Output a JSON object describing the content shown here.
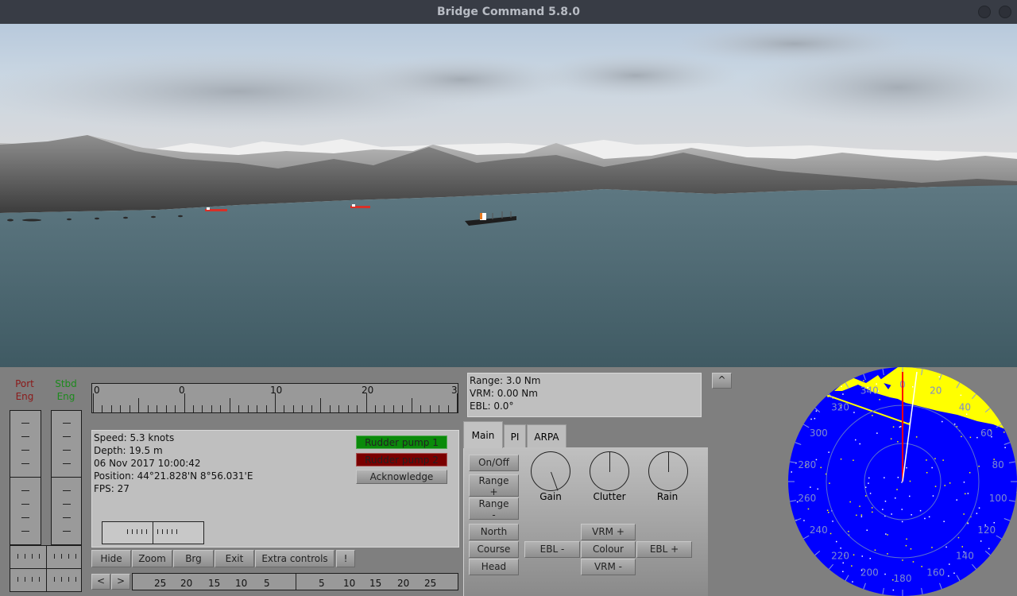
{
  "window": {
    "title": "Bridge Command 5.8.0",
    "controls": [
      "minimize-button",
      "close-button"
    ]
  },
  "viewport": {
    "scene": "3D bridge view: overcast sky, grey mountain range along coastline, calm teal sea",
    "vessels": [
      {
        "name": "red-vessel-1",
        "color": "#d83028"
      },
      {
        "name": "red-vessel-2",
        "color": "#d83028"
      },
      {
        "name": "cargo-ship",
        "color": "#1e1e1e"
      }
    ]
  },
  "engines": {
    "port_label": "Port\nEng",
    "stbd_label": "Stbd\nEng",
    "port_color": "#8b1a1a",
    "stbd_color": "#1d8a1d"
  },
  "heading_scale": {
    "labels": [
      "0",
      "0",
      "10",
      "20",
      "3"
    ]
  },
  "info": {
    "speed": "Speed: 5.3 knots",
    "depth": "Depth: 19.5 m",
    "datetime": "06 Nov 2017 10:00:42",
    "position": "Position: 44°21.828'N 8°56.031'E",
    "fps": "FPS: 27"
  },
  "alarms": {
    "rudder_pump_1": {
      "label": "Rudder pump 1",
      "color": "#0a8a0a"
    },
    "rudder_pump_2": {
      "label": "Rudder pump 2",
      "color": "#7a0000"
    },
    "acknowledge": "Acknowledge"
  },
  "toolbar": {
    "hide": "Hide",
    "zoom": "Zoom",
    "brg": "Brg",
    "exit": "Exit",
    "extra_controls": "Extra controls",
    "alert": "!"
  },
  "rudder_scale": {
    "prev": "<",
    "next": ">",
    "port_labels": [
      "25",
      "20",
      "15",
      "10",
      "5"
    ],
    "stbd_labels": [
      "5",
      "10",
      "15",
      "20",
      "25"
    ]
  },
  "radar_info": {
    "range": "Range: 3.0 Nm",
    "vrm": "VRM: 0.00 Nm",
    "ebl": "EBL: 0.0°",
    "collapse": "^"
  },
  "radar_tabs": [
    {
      "label": "Main",
      "active": true
    },
    {
      "label": "PI",
      "active": false
    },
    {
      "label": "ARPA",
      "active": false
    }
  ],
  "radar_controls": {
    "on_off": "On/Off",
    "range_plus": "Range\n+",
    "range_minus": "Range\n-",
    "north": "North",
    "course": "Course",
    "head": "Head",
    "ebl_minus": "EBL -",
    "ebl_plus": "EBL +",
    "vrm_plus": "VRM +",
    "vrm_minus": "VRM -",
    "colour": "Colour",
    "knobs": [
      {
        "label": "Gain",
        "angle_deg": 160
      },
      {
        "label": "Clutter",
        "angle_deg": 0
      },
      {
        "label": "Rain",
        "angle_deg": 0
      }
    ]
  },
  "radar_display": {
    "background": "#0000ff",
    "echo_color": "#ffff00",
    "bearing_labels": [
      "0",
      "20",
      "40",
      "60",
      "80",
      "100",
      "120",
      "140",
      "160",
      "180",
      "200",
      "220",
      "240",
      "260",
      "280",
      "300",
      "320",
      "340"
    ],
    "heading_line_color": "#ff0000",
    "ebl_line_color": "#ffffff"
  }
}
